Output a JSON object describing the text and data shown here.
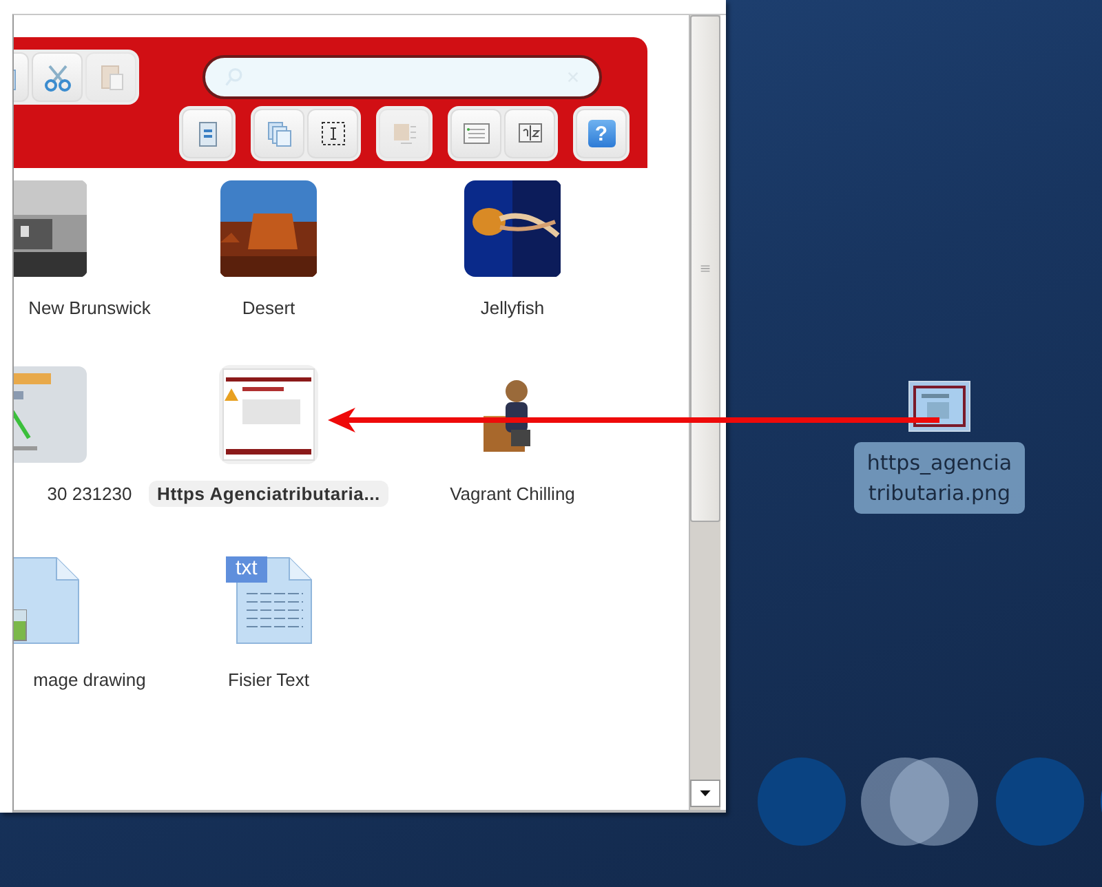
{
  "window": {
    "toolbar": {
      "top_buttons": [
        {
          "disabled": false
        },
        {
          "disabled": false
        },
        {
          "disabled": true
        }
      ],
      "bottom_buttons": [
        {
          "disabled": false
        },
        {
          "disabled": false
        },
        {
          "disabled": false
        },
        {
          "disabled": true
        },
        {
          "disabled": false
        },
        {
          "disabled": false
        },
        {
          "disabled": false
        }
      ],
      "help_label": "?"
    },
    "files": [
      {
        "name": "New Brunswick",
        "kind": "picture",
        "selected": false
      },
      {
        "name": "Desert",
        "kind": "picture",
        "selected": false
      },
      {
        "name": "Jellyfish",
        "kind": "picture",
        "selected": false
      },
      {
        "name": "30 231230",
        "kind": "picture",
        "selected": false
      },
      {
        "name": "Https Agenciatributaria...",
        "kind": "picture",
        "selected": true
      },
      {
        "name": "Vagrant Chilling",
        "kind": "picture",
        "selected": false
      },
      {
        "name": "mage drawing",
        "kind": "image-file",
        "selected": false
      },
      {
        "name": "Fisier Text",
        "kind": "text-file",
        "badge": "txt",
        "selected": false
      }
    ]
  },
  "desktop": {
    "file": {
      "lines": [
        "https_agencia",
        "tributaria.png"
      ],
      "selected": true
    }
  }
}
